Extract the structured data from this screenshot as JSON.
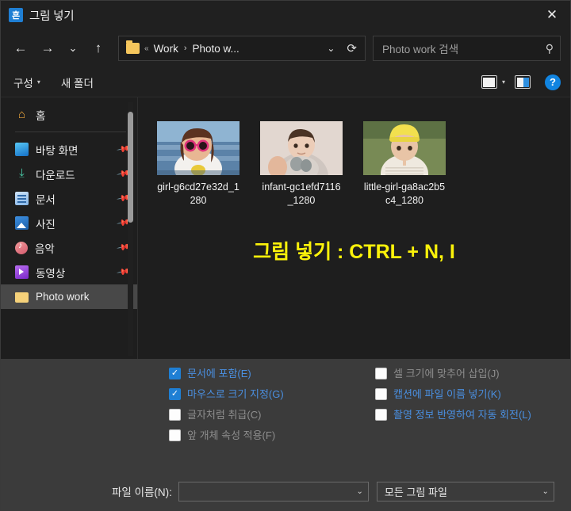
{
  "window": {
    "title": "그림 넣기",
    "app_icon_glyph": "흔",
    "close_label": "✕"
  },
  "nav": {
    "back_icon": "←",
    "forward_icon": "→",
    "recent_icon": "⌄",
    "up_icon": "↑",
    "breadcrumb": {
      "root_sep": "«",
      "items": [
        "Work",
        "Photo w..."
      ],
      "separator": "›",
      "dropdown_icon": "⌄",
      "refresh_icon": "⟳"
    },
    "search": {
      "placeholder": "Photo work 검색",
      "icon": "⚲"
    }
  },
  "toolbar": {
    "organize_label": "구성",
    "organize_caret": "▾",
    "new_folder_label": "새 폴더",
    "view_caret": "▾",
    "help_label": "?"
  },
  "sidebar": {
    "home": {
      "label": "홈",
      "icon": "home-icon"
    },
    "items": [
      {
        "label": "바탕 화면",
        "icon": "desktop-icon",
        "pinned": true
      },
      {
        "label": "다운로드",
        "icon": "download-icon",
        "pinned": true
      },
      {
        "label": "문서",
        "icon": "documents-icon",
        "pinned": true
      },
      {
        "label": "사진",
        "icon": "pictures-icon",
        "pinned": true
      },
      {
        "label": "음악",
        "icon": "music-icon",
        "pinned": true
      },
      {
        "label": "동영상",
        "icon": "videos-icon",
        "pinned": true
      },
      {
        "label": "Photo work",
        "icon": "folder-icon",
        "pinned": false,
        "selected": true
      }
    ],
    "pin_icon": "📌"
  },
  "files": [
    {
      "name": "girl-g6cd27e32d_1280",
      "thumb": "girl-with-sunglasses"
    },
    {
      "name": "infant-gc1efd7116_1280",
      "thumb": "infant-portrait"
    },
    {
      "name": "little-girl-ga8ac2b5c4_1280",
      "thumb": "little-girl-yellow-hat"
    }
  ],
  "overlay": {
    "text": "그림 넣기 : CTRL + N, I",
    "color": "#fbf20a"
  },
  "options": {
    "left": [
      {
        "label": "문서에 포함(E)",
        "checked": true,
        "enabled": true
      },
      {
        "label": "마우스로 크기 지정(G)",
        "checked": true,
        "enabled": true
      },
      {
        "label": "글자처럼 취급(C)",
        "checked": false,
        "enabled": false
      },
      {
        "label": "앞 개체 속성 적용(F)",
        "checked": false,
        "enabled": false
      }
    ],
    "right": [
      {
        "label": "셀 크기에 맞추어 삽입(J)",
        "checked": false,
        "enabled": false
      },
      {
        "label": "캡션에 파일 이름 넣기(K)",
        "checked": false,
        "enabled": true
      },
      {
        "label": "촬영 정보 반영하여 자동 회전(L)",
        "checked": false,
        "enabled": true
      }
    ],
    "check_glyph": "✓"
  },
  "footer": {
    "filename_label": "파일 이름(N):",
    "filename_value": "",
    "filetype_value": "모든 그림 파일",
    "caret": "⌄"
  }
}
